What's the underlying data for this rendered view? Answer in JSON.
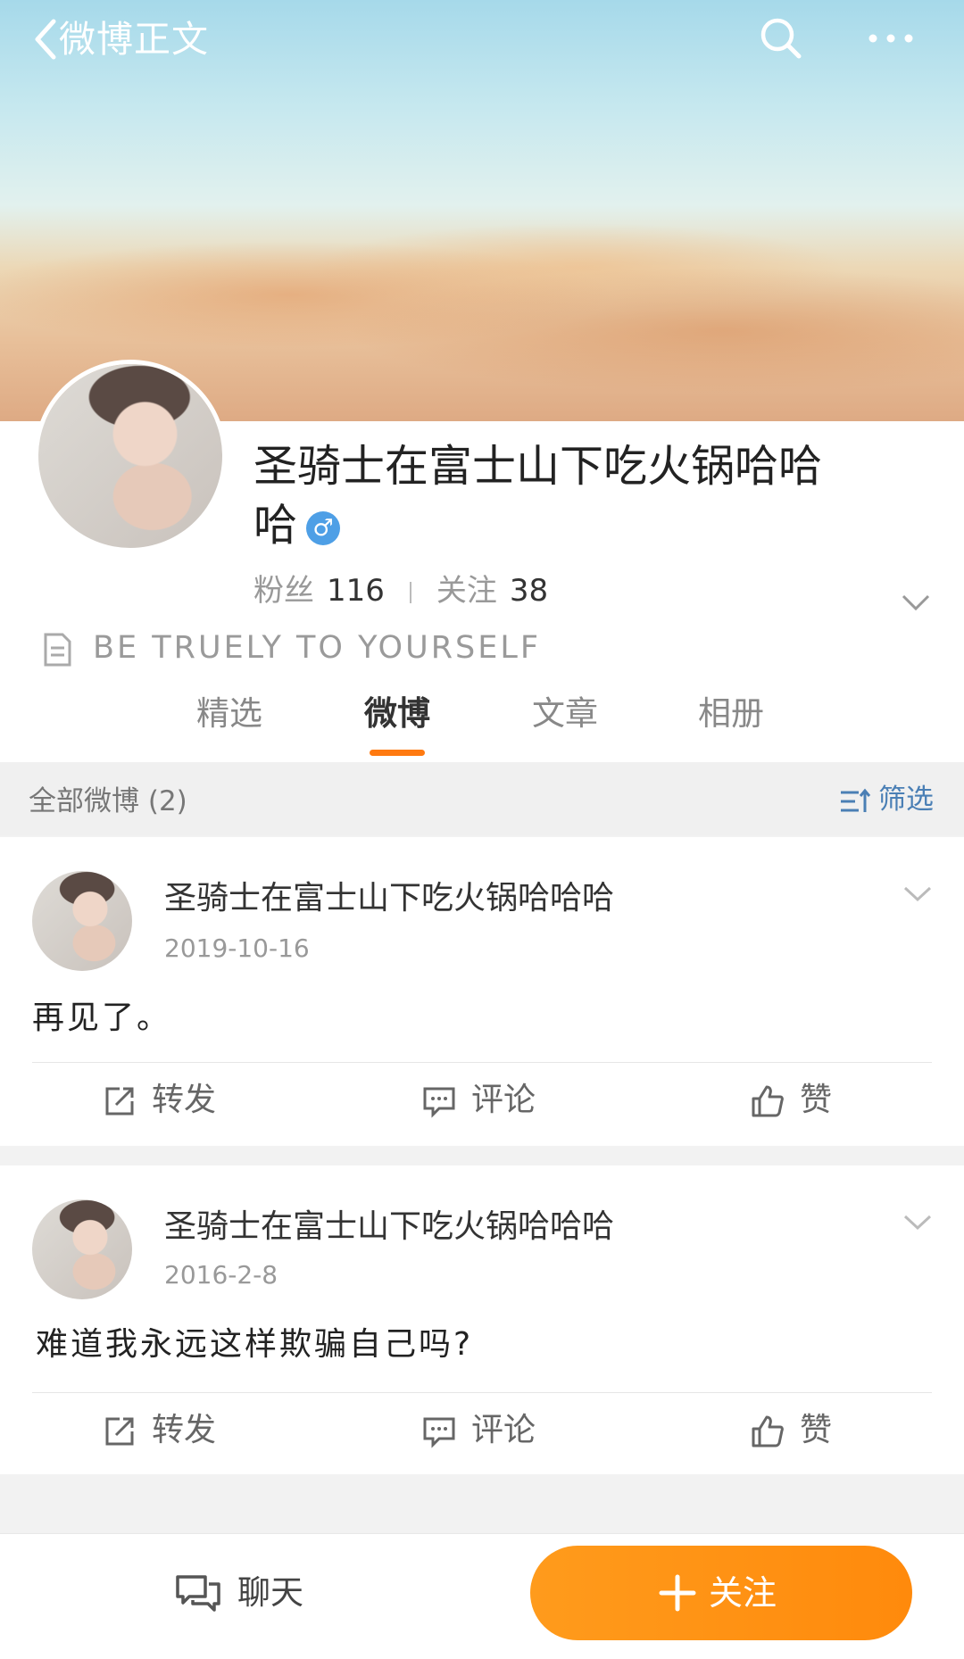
{
  "header": {
    "title": "微博正文",
    "back_icon": "chevron-left-icon",
    "search_icon": "search-icon",
    "more_icon": "more-horizontal-icon"
  },
  "profile": {
    "username": "圣骑士在富士山下吃火锅哈哈哈",
    "gender_symbol": "♂",
    "fans_label": "粉丝",
    "fans_count": "116",
    "following_label": "关注",
    "following_count": "38",
    "motto": "BE TRUELY TO YOURSELF"
  },
  "tabs": [
    {
      "label": "精选",
      "active": false
    },
    {
      "label": "微博",
      "active": true
    },
    {
      "label": "文章",
      "active": false
    },
    {
      "label": "相册",
      "active": false
    }
  ],
  "filter": {
    "label": "全部微博 (2)",
    "button": "筛选"
  },
  "posts": [
    {
      "author": "圣骑士在富士山下吃火锅哈哈哈",
      "date": "2019-10-16",
      "text": "再见了。",
      "actions": {
        "repost": "转发",
        "comment": "评论",
        "like": "赞"
      }
    },
    {
      "author": "圣骑士在富士山下吃火锅哈哈哈",
      "date": "2016-2-8",
      "text": "难道我永远这样欺骗自己吗?",
      "actions": {
        "repost": "转发",
        "comment": "评论",
        "like": "赞"
      }
    }
  ],
  "bottom": {
    "chat": "聊天",
    "follow": "关注"
  },
  "colors": {
    "accent": "#ff8a0c",
    "tab_indicator": "#ff7a10",
    "link_blue": "#4a7fb5",
    "gender_blue": "#4e9fe6"
  }
}
